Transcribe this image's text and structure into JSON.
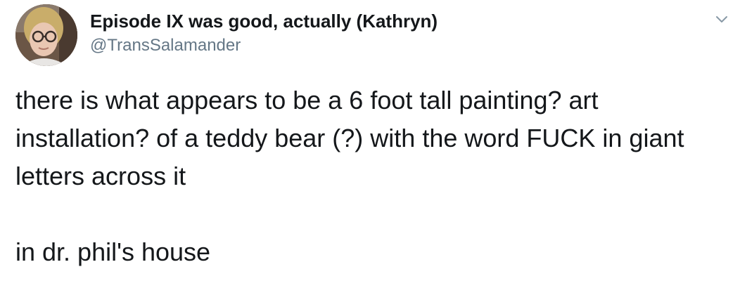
{
  "tweet": {
    "author": {
      "display_name": "Episode IX was good, actually (Kathryn)",
      "handle": "@TransSalamander",
      "avatar_icon": "profile-photo"
    },
    "menu_icon": "chevron-down-icon",
    "text": {
      "paragraph_1": "there is what appears to be a 6 foot tall painting? art installation? of a teddy bear (?) with the word FUCK in giant letters across it",
      "paragraph_2": "in dr. phil's house"
    },
    "colors": {
      "text_primary": "#14171a",
      "text_secondary": "#657786",
      "background": "#ffffff"
    }
  }
}
